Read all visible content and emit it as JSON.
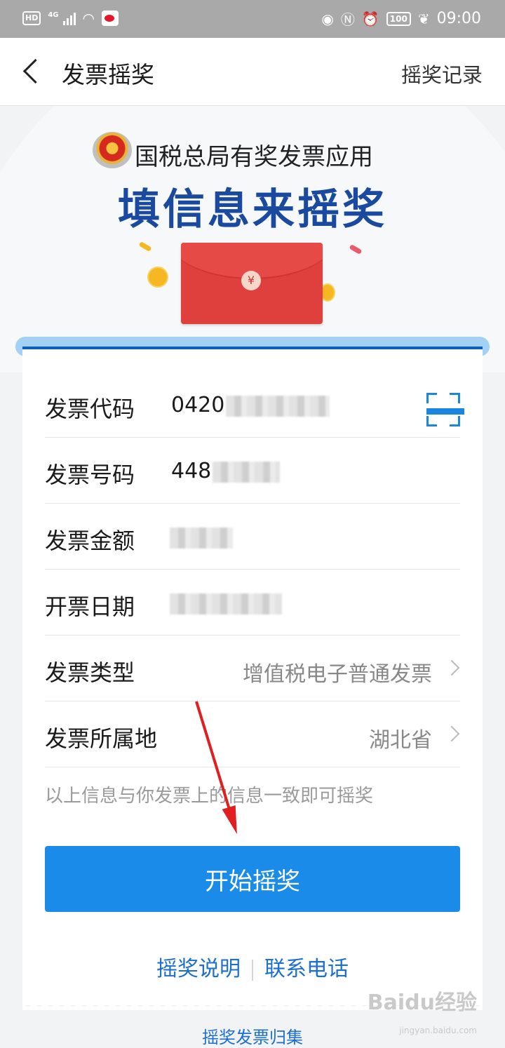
{
  "status_bar": {
    "left_badge": "HD",
    "network": "4G",
    "battery": "100",
    "time": "09:00"
  },
  "nav": {
    "title": "发票摇奖",
    "record_link": "摇奖记录"
  },
  "hero": {
    "app_name": "国税总局有奖发票应用",
    "slogan": "填信息来摇奖",
    "envelope_symbol": "¥"
  },
  "form": {
    "invoice_code": {
      "label": "发票代码",
      "value": "0420"
    },
    "invoice_number": {
      "label": "发票号码",
      "value": "448"
    },
    "invoice_amount": {
      "label": "发票金额",
      "value": ""
    },
    "invoice_date": {
      "label": "开票日期",
      "value": ""
    },
    "invoice_type": {
      "label": "发票类型",
      "value": "增值税电子普通发票"
    },
    "invoice_region": {
      "label": "发票所属地",
      "value": "湖北省"
    },
    "hint": "以上信息与你发票上的信息一致即可摇奖"
  },
  "actions": {
    "start_button": "开始摇奖",
    "rules_link": "摇奖说明",
    "contact_link": "联系电话",
    "collect_link": "摇奖发票归集"
  },
  "watermark": {
    "brand": "Baidu经验",
    "url": "jingyan.baidu.com"
  },
  "colors": {
    "primary": "#1a8be8",
    "title_blue": "#1a4aa0",
    "link_blue": "#1a6fd1",
    "envelope_red": "#e0403d",
    "annotation_arrow": "#e02020"
  }
}
